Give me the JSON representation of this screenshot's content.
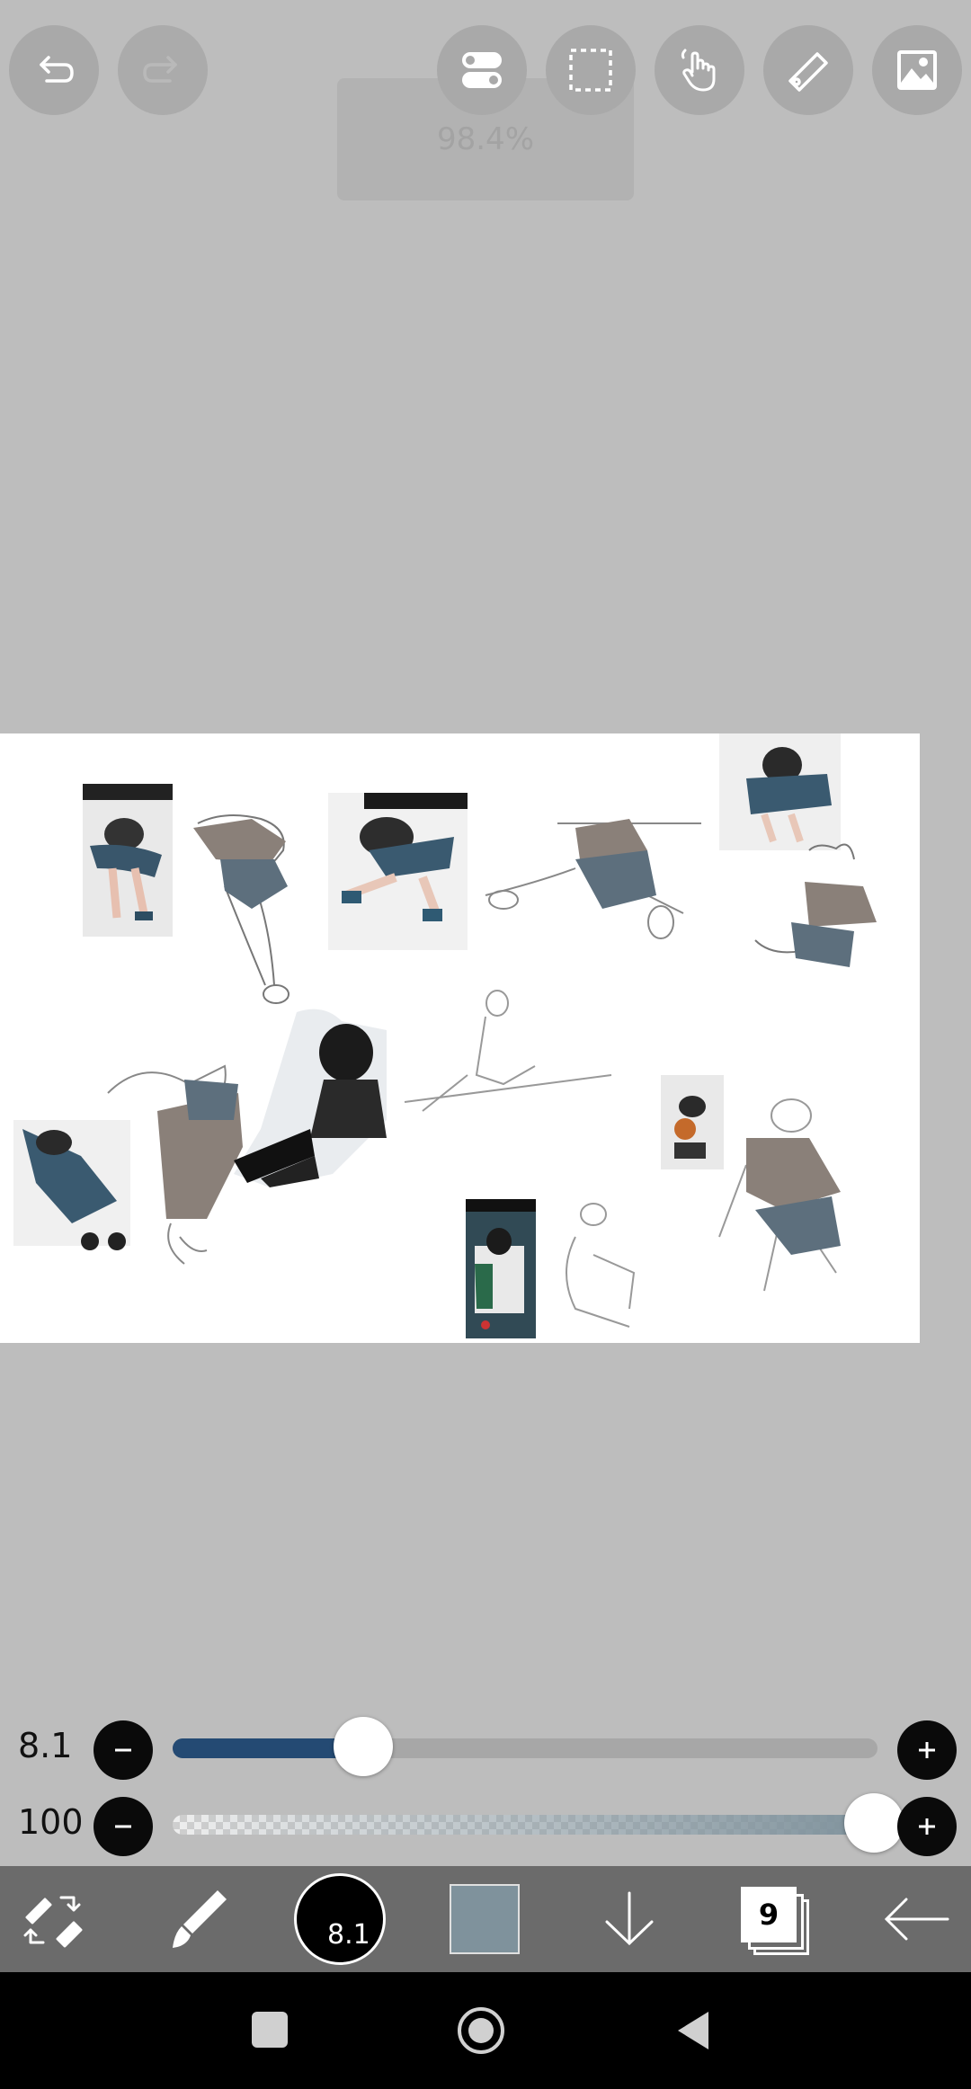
{
  "top_bar": {
    "buttons": [
      {
        "name": "undo-button",
        "icon": "undo-icon"
      },
      {
        "name": "redo-button",
        "icon": "redo-icon"
      },
      {
        "name": "toggle-settings-button",
        "icon": "toggle-icon"
      },
      {
        "name": "selection-button",
        "icon": "selection-marquee-icon"
      },
      {
        "name": "hand-tool-button",
        "icon": "hand-icon"
      },
      {
        "name": "ruler-button",
        "icon": "ruler-icon"
      },
      {
        "name": "image-button",
        "icon": "image-icon"
      }
    ],
    "zoom_toast": "98.4%"
  },
  "brush_size": {
    "label": "8.1",
    "value": 8.1,
    "fraction": 0.27,
    "fill_color": "#244a73"
  },
  "opacity": {
    "label": "100",
    "value": 100,
    "fraction": 1.0,
    "tint_color": "#7f929c"
  },
  "toolbar": {
    "brush_size_badge": "8.1",
    "current_color": "#7f929c",
    "layer_count": "9"
  },
  "colors": {
    "background": "#bdbdbd",
    "toolbar": "#6b6b6b",
    "nav_bar": "#000000"
  }
}
